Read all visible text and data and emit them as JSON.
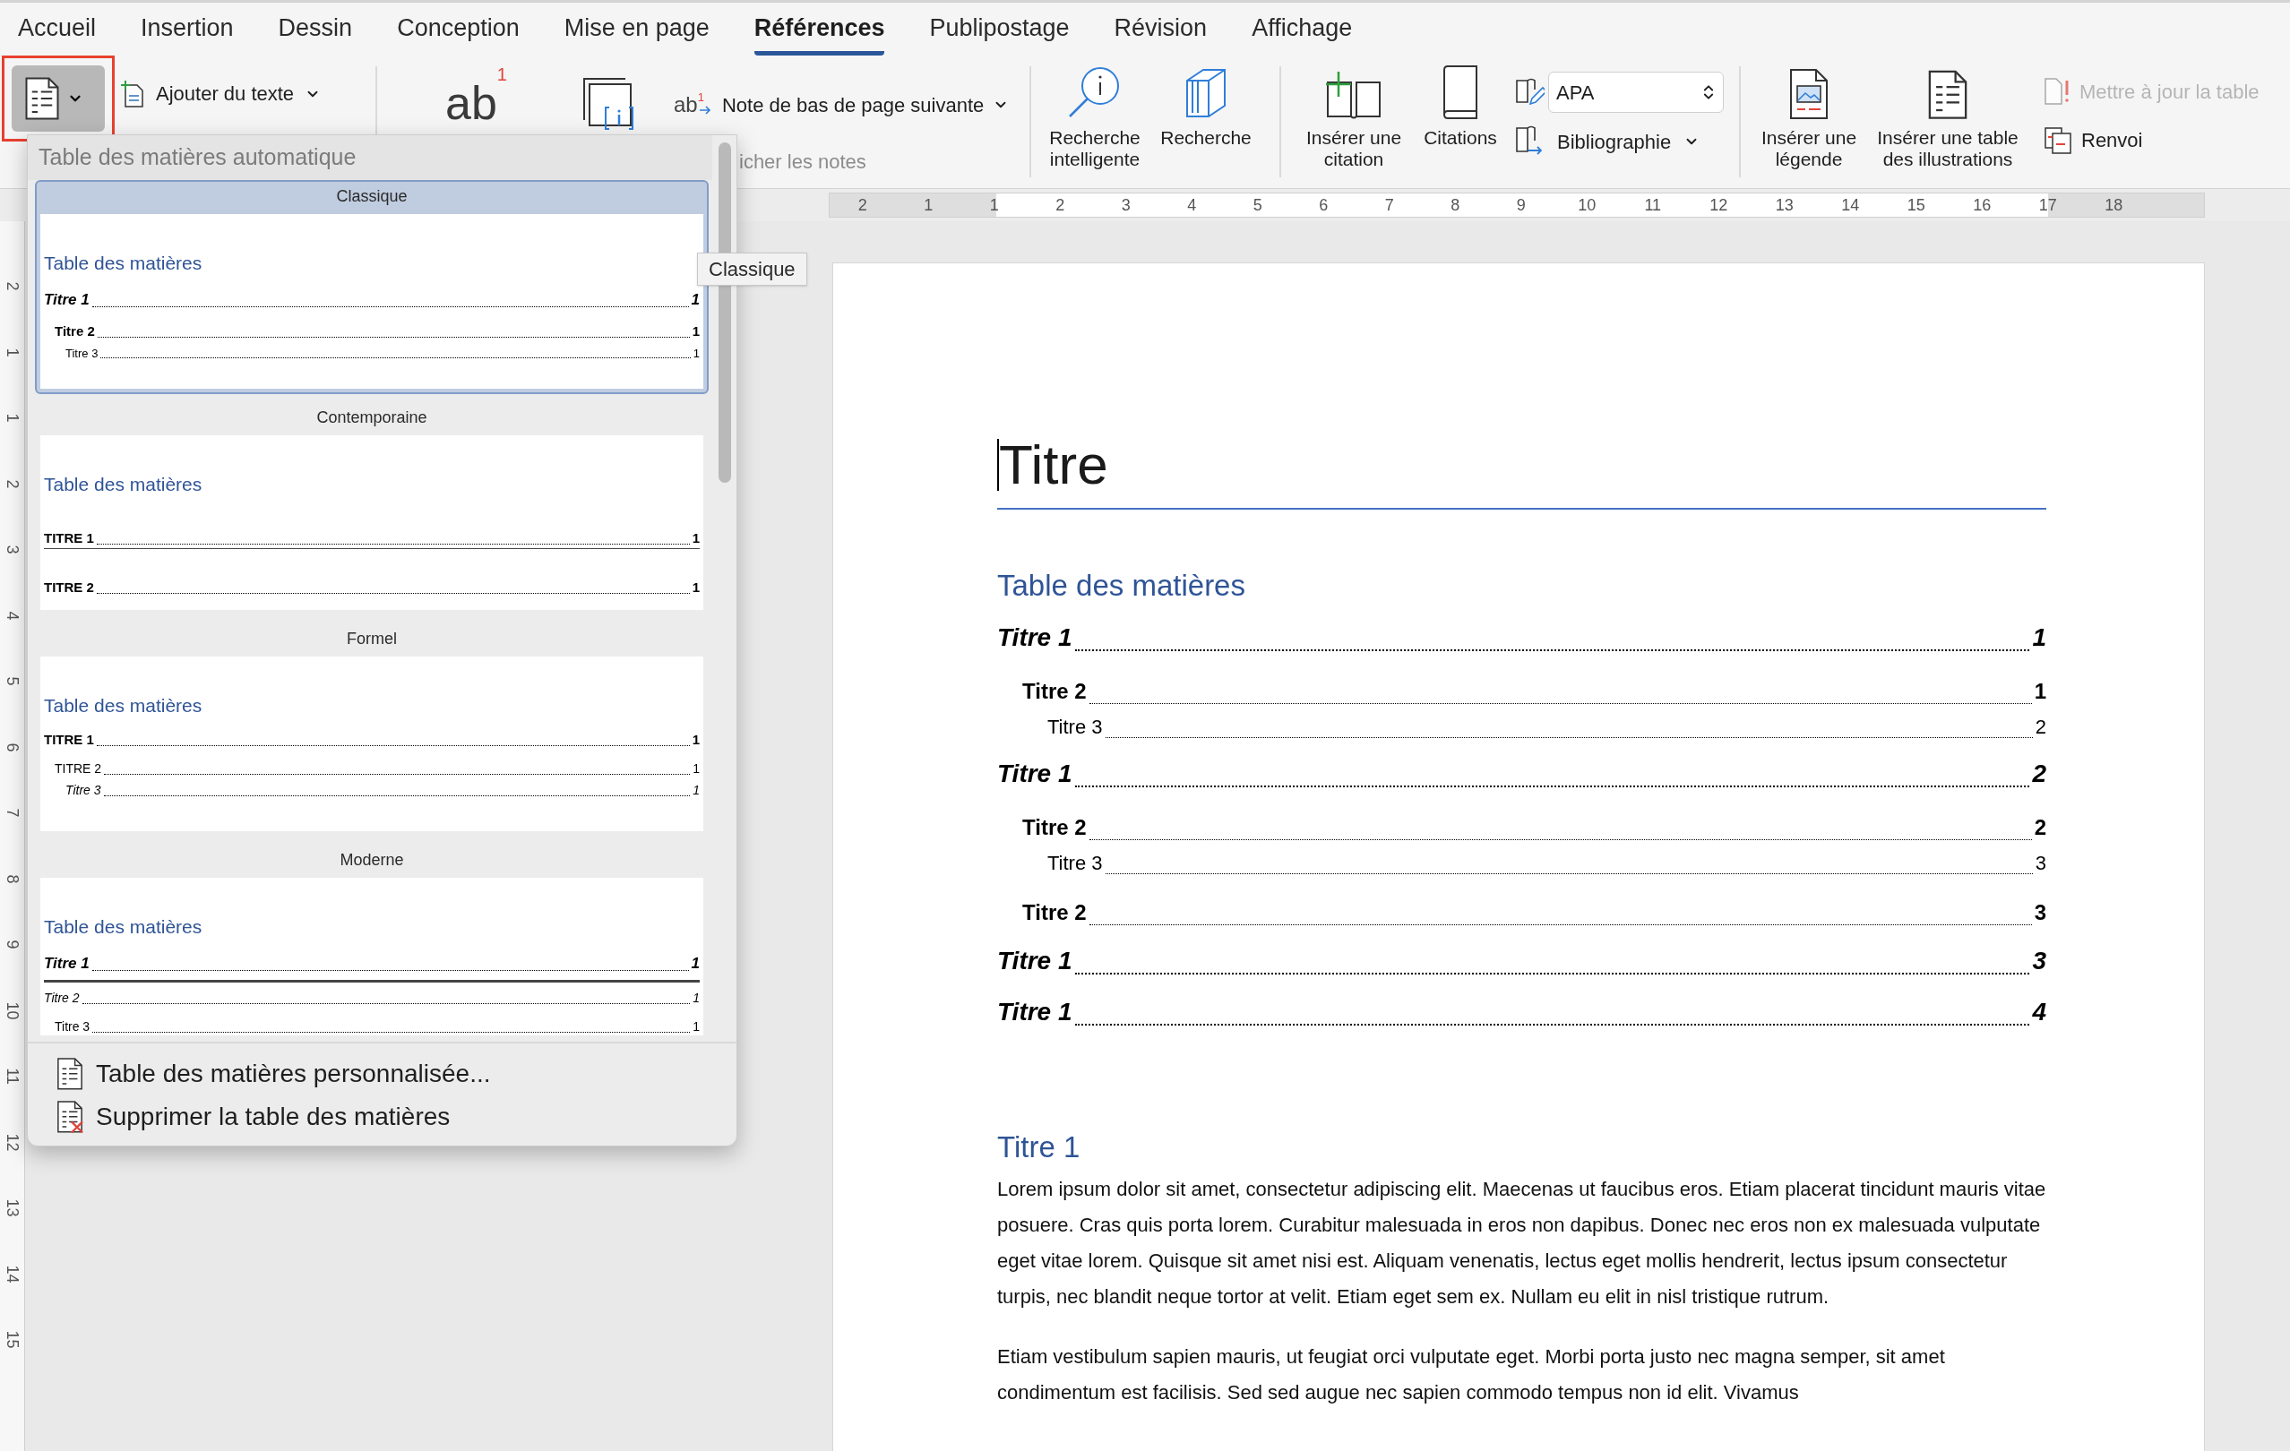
{
  "tabs": [
    {
      "label": "Accueil",
      "selected": false
    },
    {
      "label": "Insertion",
      "selected": false
    },
    {
      "label": "Dessin",
      "selected": false
    },
    {
      "label": "Conception",
      "selected": false
    },
    {
      "label": "Mise en page",
      "selected": false
    },
    {
      "label": "Références",
      "selected": true
    },
    {
      "label": "Publipostage",
      "selected": false
    },
    {
      "label": "Révision",
      "selected": false
    },
    {
      "label": "Affichage",
      "selected": false
    }
  ],
  "ribbon": {
    "toc_button": {
      "pressed": true,
      "outlined": true
    },
    "add_text": "Ajouter du texte",
    "footnote": {
      "glyph": "ab",
      "mark": "1"
    },
    "next_footnote": {
      "glyph": "ab",
      "mark": "1",
      "label": "Note de bas de page suivante"
    },
    "show_notes": {
      "label": "icher les notes",
      "disabled": true
    },
    "smart_lookup": "Recherche intelligente",
    "researcher": "Recherche",
    "insert_citation": "Insérer une citation",
    "citations": "Citations",
    "style_field": {
      "value": "APA"
    },
    "bibliography": "Bibliographie",
    "insert_caption": "Insérer une légende",
    "insert_table_figures": "Insérer une table des illustrations",
    "update_table": {
      "label": "Mettre à jour la table",
      "disabled": true
    },
    "cross_reference": "Renvoi"
  },
  "ruler": {
    "horizontal": [
      "2",
      "1",
      "1",
      "2",
      "3",
      "4",
      "5",
      "6",
      "7",
      "8",
      "9",
      "10",
      "11",
      "12",
      "13",
      "14",
      "15",
      "16",
      "17",
      "18"
    ],
    "vertical": [
      "2",
      "1",
      "1",
      "2",
      "3",
      "4",
      "5",
      "6",
      "7",
      "8",
      "9",
      "10",
      "11",
      "12",
      "13",
      "14",
      "15"
    ]
  },
  "toc_menu": {
    "header": "Table des matières automatique",
    "gallery": [
      {
        "name": "Classique",
        "kind": "classique",
        "selected": true,
        "heading": "Table des matières",
        "entries": [
          {
            "title": "Titre 1",
            "page": "1",
            "children": [
              {
                "title": "Titre 2",
                "page": "1",
                "children": [
                  {
                    "title": "Titre 3",
                    "page": "1"
                  }
                ]
              }
            ]
          }
        ]
      },
      {
        "name": "Contemporaine",
        "kind": "contemporaine",
        "selected": false,
        "heading": "Table des matières",
        "entries": [
          {
            "title": "TITRE 1",
            "page": "1",
            "children": [
              {
                "title": "TITRE 2",
                "page": "1"
              }
            ]
          }
        ]
      },
      {
        "name": "Formel",
        "kind": "formel",
        "selected": false,
        "heading": "Table des matières",
        "entries": [
          {
            "title": "TITRE 1",
            "page": "1",
            "children": [
              {
                "title": "TITRE 2",
                "page": "1",
                "children": [
                  {
                    "title": "Titre 3",
                    "page": "1"
                  }
                ]
              }
            ]
          }
        ]
      },
      {
        "name": "Moderne",
        "kind": "moderne",
        "selected": false,
        "heading": "Table des matières",
        "entries": [
          {
            "title": "Titre 1",
            "page": "1",
            "children": [
              {
                "title": "Titre 2",
                "page": "1",
                "children": [
                  {
                    "title": "Titre 3",
                    "page": "1"
                  }
                ]
              }
            ]
          }
        ]
      }
    ],
    "actions": [
      {
        "kind": "custom",
        "label": "Table des matières personnalisée..."
      },
      {
        "kind": "remove",
        "label": "Supprimer la table des matières"
      }
    ],
    "tooltip": "Classique"
  },
  "document": {
    "title": "Titre",
    "toc": {
      "heading": "Table des matières",
      "entries": [
        {
          "title": "Titre 1",
          "page": "1",
          "children": [
            {
              "title": "Titre 2",
              "page": "1",
              "children": [
                {
                  "title": "Titre 3",
                  "page": "2"
                }
              ]
            }
          ]
        },
        {
          "title": "Titre 1",
          "page": "2",
          "children": [
            {
              "title": "Titre 2",
              "page": "2",
              "children": [
                {
                  "title": "Titre 3",
                  "page": "3"
                }
              ]
            },
            {
              "title": "Titre 2",
              "page": "3"
            }
          ]
        },
        {
          "title": "Titre 1",
          "page": "3"
        },
        {
          "title": "Titre 1",
          "page": "4"
        }
      ]
    },
    "sections": [
      {
        "heading": "Titre 1",
        "paragraphs": [
          "Lorem ipsum dolor sit amet, consectetur adipiscing elit. Maecenas ut faucibus eros. Etiam placerat tincidunt mauris vitae posuere. Cras quis porta lorem. Curabitur malesuada in eros non dapibus. Donec nec eros non ex malesuada vulputate eget vitae lorem. Quisque sit amet nisi est. Aliquam venenatis, lectus eget mollis hendrerit, lectus ipsum consectetur turpis, nec blandit neque tortor at velit. Etiam eget sem ex. Nullam eu elit in nisl tristique rutrum.",
          "Etiam vestibulum sapien mauris, ut feugiat orci vulputate eget. Morbi porta justo nec magna semper, sit amet condimentum est facilisis. Sed sed augue nec sapien commodo tempus non id elit. Vivamus"
        ]
      }
    ]
  }
}
